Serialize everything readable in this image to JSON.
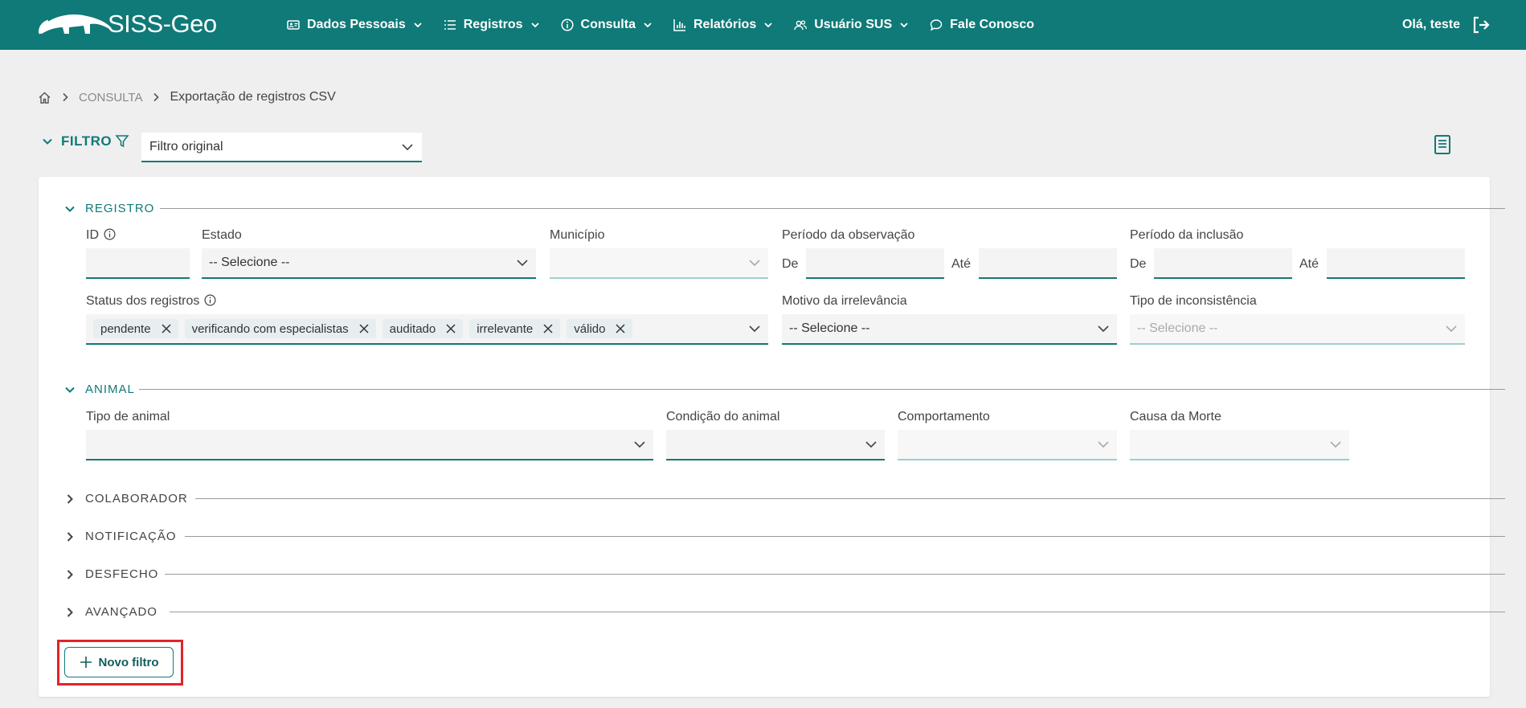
{
  "app": {
    "name": "SISS-Geo"
  },
  "nav": {
    "items": [
      {
        "label": "Dados Pessoais",
        "icon": "id-card-icon",
        "dropdown": true
      },
      {
        "label": "Registros",
        "icon": "list-icon",
        "dropdown": true
      },
      {
        "label": "Consulta",
        "icon": "info-icon",
        "dropdown": true
      },
      {
        "label": "Relatórios",
        "icon": "bar-chart-icon",
        "dropdown": true
      },
      {
        "label": "Usuário SUS",
        "icon": "users-icon",
        "dropdown": true
      },
      {
        "label": "Fale Conosco",
        "icon": "chat-icon",
        "dropdown": false
      }
    ],
    "greeting": "Olá, teste"
  },
  "breadcrumb": {
    "section": "CONSULTA",
    "current": "Exportação de registros CSV"
  },
  "filter": {
    "label": "FILTRO",
    "selected_filter": "Filtro original"
  },
  "registro": {
    "title": "REGISTRO",
    "id_label": "ID",
    "estado_label": "Estado",
    "estado_value": "-- Selecione --",
    "municipio_label": "Município",
    "periodo_obs_label": "Período da observação",
    "periodo_inc_label": "Período da inclusão",
    "de": "De",
    "ate": "Até",
    "status_label": "Status dos registros",
    "status_chips": [
      "pendente",
      "verificando com especialistas",
      "auditado",
      "irrelevante",
      "válido"
    ],
    "motivo_label": "Motivo da irrelevância",
    "motivo_value": "-- Selecione --",
    "tipo_inconsistencia_label": "Tipo de inconsistência",
    "tipo_inconsistencia_value": "-- Selecione --"
  },
  "animal": {
    "title": "ANIMAL",
    "tipo_label": "Tipo de animal",
    "condicao_label": "Condição do animal",
    "comportamento_label": "Comportamento",
    "causa_label": "Causa da Morte"
  },
  "sections": {
    "colaborador": "COLABORADOR",
    "notificacao": "NOTIFICAÇÃO",
    "desfecho": "DESFECHO",
    "avancado": "AVANÇADO"
  },
  "actions": {
    "new_filter": "Novo filtro"
  },
  "colors": {
    "primary": "#0f7a78",
    "highlight": "#e2232a",
    "background": "#efefef"
  }
}
